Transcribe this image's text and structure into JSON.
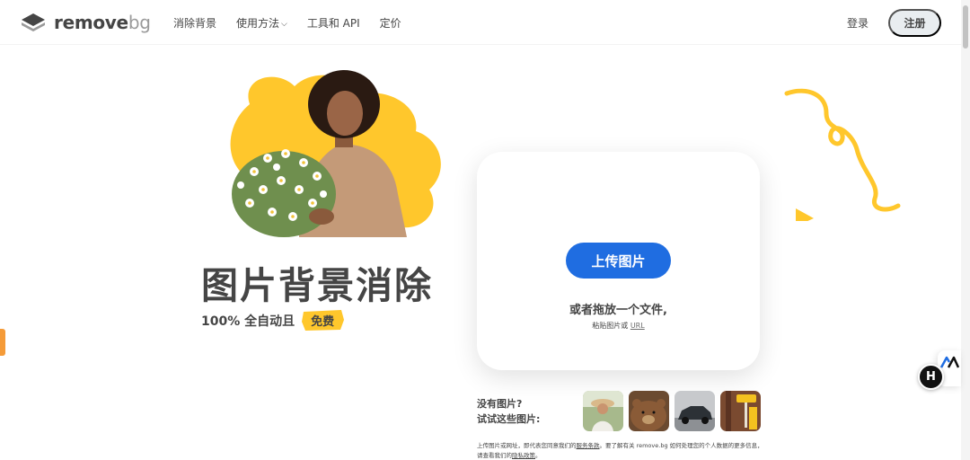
{
  "header": {
    "logo_text": "remove",
    "logo_suffix": "bg",
    "nav": {
      "remove_bg": "消除背景",
      "how_to": "使用方法",
      "tools_api": "工具和 API",
      "pricing": "定价"
    },
    "login": "登录",
    "signup": "注册"
  },
  "hero": {
    "title": "图片背景消除",
    "subtitle": "100% 全自动且",
    "free_badge": "免费"
  },
  "upload": {
    "button": "上传图片",
    "drop_text": "或者拖放一个文件,",
    "paste_prefix": "粘贴图片或",
    "paste_url": "URL"
  },
  "samples": {
    "line1": "没有图片?",
    "line2": "试试这些图片:",
    "items": [
      "woman-with-hat",
      "bear",
      "car",
      "paint-roller"
    ]
  },
  "legal": {
    "part1": "上传图片或网址，即代表您同意我们的",
    "terms_link": "服务条款",
    "part2": "。要了解有关 remove.bg 如何处理您的个人数据的更多信息，请查看我们的",
    "privacy_link": "隐私政策",
    "part3": "。"
  },
  "widgets": {
    "chat_letter": "H"
  },
  "colors": {
    "accent_blue": "#1f6de1",
    "brand_yellow": "#ffc72c",
    "text_dark": "#454545"
  }
}
